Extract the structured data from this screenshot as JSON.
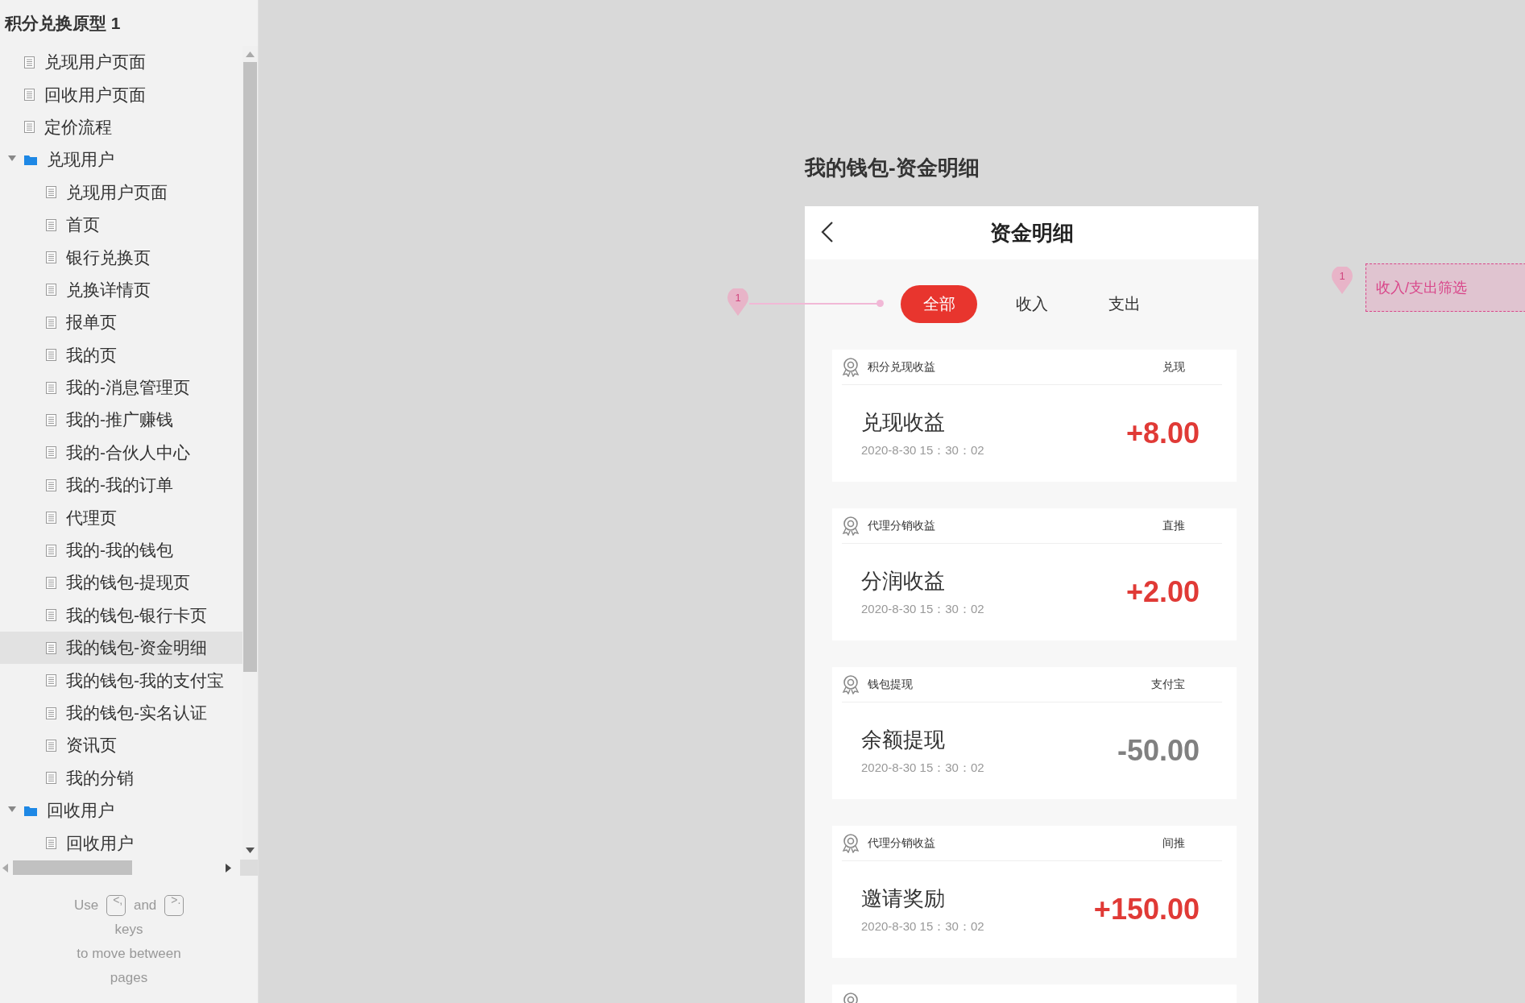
{
  "sidebar": {
    "title": "积分兑换原型 1",
    "items": [
      {
        "kind": "page",
        "label": "兑现用户页面",
        "selected": false
      },
      {
        "kind": "page",
        "label": "回收用户页面",
        "selected": false
      },
      {
        "kind": "page",
        "label": "定价流程",
        "selected": false
      },
      {
        "kind": "folder",
        "label": "兑现用户",
        "selected": false,
        "expanded": true,
        "children": [
          {
            "kind": "page",
            "label": "兑现用户页面",
            "selected": false
          },
          {
            "kind": "page",
            "label": "首页",
            "selected": false
          },
          {
            "kind": "page",
            "label": "银行兑换页",
            "selected": false
          },
          {
            "kind": "page",
            "label": "兑换详情页",
            "selected": false
          },
          {
            "kind": "page",
            "label": "报单页",
            "selected": false
          },
          {
            "kind": "page",
            "label": "我的页",
            "selected": false
          },
          {
            "kind": "page",
            "label": "我的-消息管理页",
            "selected": false
          },
          {
            "kind": "page",
            "label": "我的-推广赚钱",
            "selected": false
          },
          {
            "kind": "page",
            "label": "我的-合伙人中心",
            "selected": false
          },
          {
            "kind": "page",
            "label": "我的-我的订单",
            "selected": false
          },
          {
            "kind": "page",
            "label": "代理页",
            "selected": false
          },
          {
            "kind": "page",
            "label": "我的-我的钱包",
            "selected": false
          },
          {
            "kind": "page",
            "label": "我的钱包-提现页",
            "selected": false
          },
          {
            "kind": "page",
            "label": "我的钱包-银行卡页",
            "selected": false
          },
          {
            "kind": "page",
            "label": "我的钱包-资金明细",
            "selected": true
          },
          {
            "kind": "page",
            "label": "我的钱包-我的支付宝",
            "selected": false
          },
          {
            "kind": "page",
            "label": "我的钱包-实名认证",
            "selected": false
          },
          {
            "kind": "page",
            "label": "资讯页",
            "selected": false
          },
          {
            "kind": "page",
            "label": "我的分销",
            "selected": false
          }
        ]
      },
      {
        "kind": "folder",
        "label": "回收用户",
        "selected": false,
        "expanded": true,
        "children": [
          {
            "kind": "page",
            "label": "回收用户",
            "selected": false
          }
        ]
      }
    ],
    "help": {
      "before": "Use",
      "key_prev": "<,",
      "middle": "and",
      "key_next": ">.",
      "lines": [
        "keys",
        "to move between",
        "pages"
      ]
    }
  },
  "page_title": "我的钱包-资金明细",
  "phone": {
    "title": "资金明细",
    "tabs": [
      {
        "label": "全部",
        "selected": true
      },
      {
        "label": "收入",
        "selected": false
      },
      {
        "label": "支出",
        "selected": false
      }
    ],
    "records": [
      {
        "kind": "income",
        "category": "积分兑现收益",
        "tag": "兑现",
        "title": "兑现收益",
        "time": "2020-8-30 15：30：02",
        "amount": "+8.00"
      },
      {
        "kind": "income",
        "category": "代理分销收益",
        "tag": "直推",
        "title": "分润收益",
        "time": "2020-8-30 15：30：02",
        "amount": "+2.00"
      },
      {
        "kind": "expense",
        "category": "钱包提现",
        "tag": "支付宝",
        "title": "余额提现",
        "time": "2020-8-30 15：30：02",
        "amount": "-50.00"
      },
      {
        "kind": "income",
        "category": "代理分销收益",
        "tag": "间推",
        "title": "邀请奖励",
        "time": "2020-8-30 15：30：02",
        "amount": "+150.00"
      },
      {
        "kind": "partial"
      }
    ]
  },
  "annotations": [
    {
      "kind": "leader",
      "number": "1"
    },
    {
      "kind": "note",
      "number": "1",
      "note": "收入/支出筛选"
    }
  ]
}
